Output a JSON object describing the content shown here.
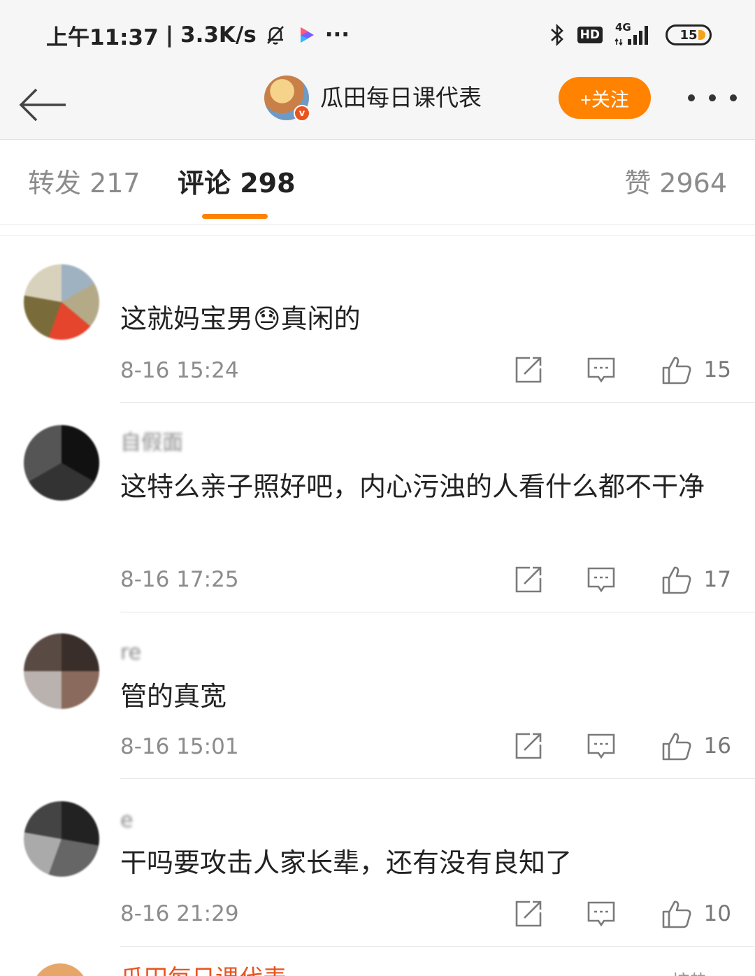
{
  "status_bar": {
    "time": "上午11:37",
    "separator": "|",
    "speed": "3.3K/s",
    "more": "···",
    "net": "4G",
    "hd": "HD",
    "battery": "15",
    "icons": [
      "bell-off-icon",
      "video-app-icon",
      "bluetooth-icon",
      "signal-icon",
      "battery-icon"
    ]
  },
  "header": {
    "title": "瓜田每日课代表",
    "verified_badge": "v",
    "follow_label": "+关注",
    "accent": "#ff8200"
  },
  "tabs": [
    {
      "label": "转发 217"
    },
    {
      "label": "评论 298"
    },
    {
      "label": "赞 2964"
    }
  ],
  "comments": [
    {
      "text": "这就妈宝男😓真闲的",
      "time": "8-16 15:24",
      "likes": "15"
    },
    {
      "nick": "自假面",
      "text": "这特么亲子照好吧，内心污浊的人看什么都不干净",
      "time": "8-16 17:25",
      "likes": "17"
    },
    {
      "nick": "re",
      "text": "管的真宽",
      "time": "8-16 15:01",
      "likes": "16"
    },
    {
      "nick": "e",
      "text": "干吗要攻击人家长辈，还有没有良知了",
      "time": "8-16 21:29",
      "likes": "10"
    }
  ],
  "peek": {
    "name": "瓜田每日课代表",
    "sort": "按热 ∨"
  }
}
